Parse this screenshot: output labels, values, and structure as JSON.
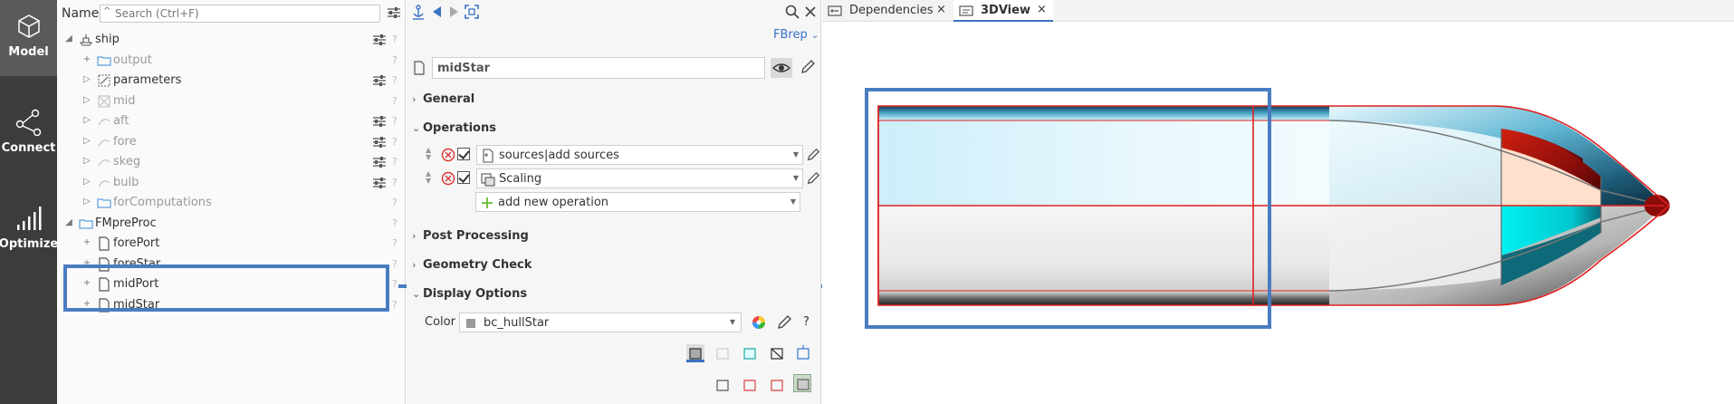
{
  "activity_bar": {
    "items": [
      {
        "label": "Model",
        "icon": "cube-icon",
        "active": true
      },
      {
        "label": "Connect",
        "icon": "connect-nodes-icon",
        "active": false
      },
      {
        "label": "Optimize",
        "icon": "bar-chart-icon",
        "active": false
      }
    ]
  },
  "tree": {
    "name_label": "Name",
    "search_placeholder": "Search (Ctrl+F)",
    "rows": [
      {
        "label": "ship",
        "icon": "ship-icon",
        "toggle": "◢",
        "dim": false
      },
      {
        "label": "output",
        "icon": "folder-icon",
        "toggle": "+",
        "dim": true
      },
      {
        "label": "parameters",
        "icon": "parameters-icon",
        "toggle": "▷",
        "dim": false
      },
      {
        "label": "mid",
        "icon": "mid-icon",
        "toggle": "▷",
        "dim": true
      },
      {
        "label": "aft",
        "icon": "curve-icon",
        "toggle": "▷",
        "dim": true
      },
      {
        "label": "fore",
        "icon": "curve-icon",
        "toggle": "▷",
        "dim": true
      },
      {
        "label": "skeg",
        "icon": "curve-icon",
        "toggle": "▷",
        "dim": true
      },
      {
        "label": "bulb",
        "icon": "curve-icon",
        "toggle": "▷",
        "dim": true
      },
      {
        "label": "forComputations",
        "icon": "folder-icon",
        "toggle": "▷",
        "dim": true
      },
      {
        "label": "FMpreProc",
        "icon": "folder-icon",
        "toggle": "◢",
        "dim": false
      },
      {
        "label": "forePort",
        "icon": "file-icon",
        "toggle": "+",
        "dim": false
      },
      {
        "label": "foreStar",
        "icon": "file-icon",
        "toggle": "+",
        "dim": false
      },
      {
        "label": "midPort",
        "icon": "file-icon",
        "toggle": "+",
        "dim": false
      },
      {
        "label": "midStar",
        "icon": "file-icon",
        "toggle": "+",
        "dim": false
      }
    ],
    "help_mark": "?"
  },
  "properties": {
    "type_link": "FBrep",
    "object_name": "midStar",
    "sections": {
      "general": "General",
      "operations": "Operations",
      "post_processing": "Post Processing",
      "geometry_check": "Geometry Check",
      "display_options": "Display Options"
    },
    "operations": [
      {
        "label": "sources|add sources",
        "icon": "add-sources-icon"
      },
      {
        "label": "Scaling",
        "icon": "scaling-icon"
      }
    ],
    "add_operation_label": "add new operation",
    "color_label": "Color",
    "color_value": "bc_hullStar",
    "color_help": "?"
  },
  "tabs": [
    {
      "label": "Dependencies",
      "icon": "dependencies-icon",
      "active": false,
      "close": "×"
    },
    {
      "label": "3DView",
      "icon": "3dview-icon",
      "active": true,
      "close": "×"
    }
  ],
  "colors": {
    "accent": "#3a72c4",
    "highlight": "#4a7cc0",
    "activity_bg": "#3c3c3c",
    "hull_edge": "#e02020",
    "cyan_face": "#00f0f0",
    "red_face": "#b01010"
  }
}
